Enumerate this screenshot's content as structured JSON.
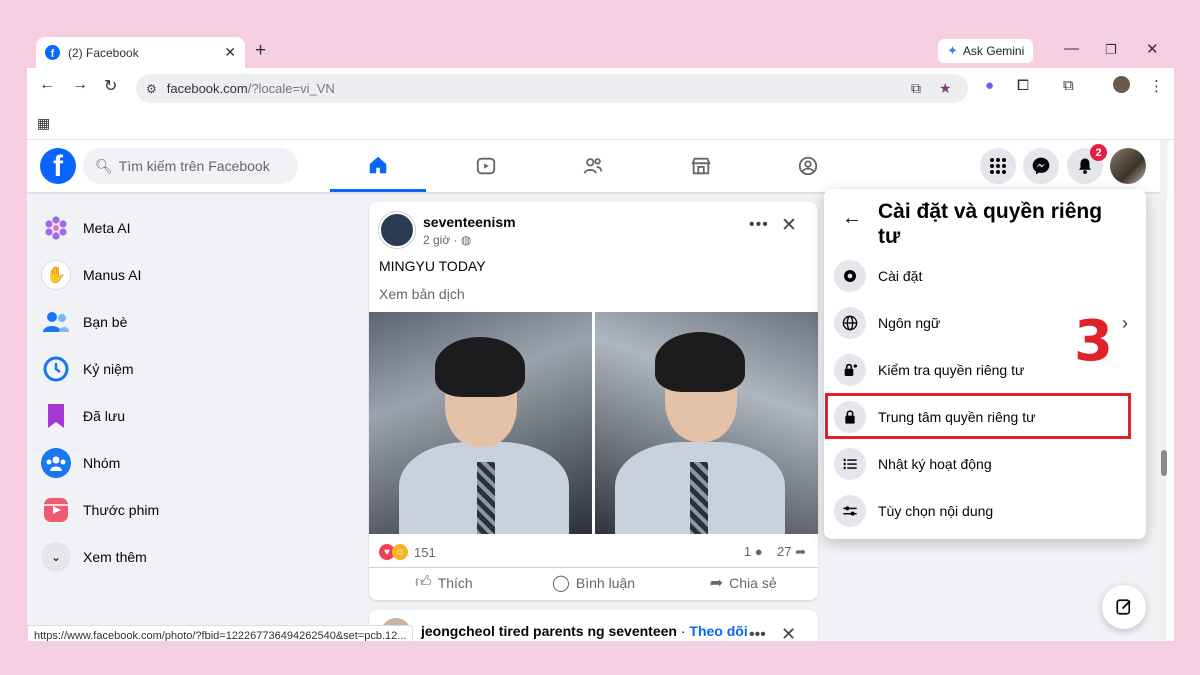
{
  "browser": {
    "tab_title": "(2) Facebook",
    "tab_close": "✕",
    "new_tab": "+",
    "ask_gemini": "Ask Gemini",
    "url_main": "facebook.com",
    "url_rest": "/?locale=vi_VN",
    "status_url": "https://www.facebook.com/photo/?fbid=122267736494262540&set=pcb.12..."
  },
  "fb": {
    "search_placeholder": "Tìm kiếm trên Facebook",
    "notification_count": "2",
    "sidebar": [
      {
        "label": "Meta AI",
        "icon": "meta-ai-icon"
      },
      {
        "label": "Manus AI",
        "icon": "manus-icon"
      },
      {
        "label": "Bạn bè",
        "icon": "friends-icon"
      },
      {
        "label": "Kỷ niệm",
        "icon": "memories-icon"
      },
      {
        "label": "Đã lưu",
        "icon": "saved-icon"
      },
      {
        "label": "Nhóm",
        "icon": "groups-icon"
      },
      {
        "label": "Thước phim",
        "icon": "reels-icon"
      },
      {
        "label": "Xem thêm",
        "icon": "chevron-down-icon"
      }
    ],
    "post": {
      "author": "seventeenism",
      "time": "2 giờ · ",
      "text": "MINGYU TODAY",
      "translate": "Xem bản dịch",
      "reaction_count": "151",
      "comment_count": "1",
      "share_count": "27",
      "like": "Thích",
      "comment": "Bình luận",
      "share": "Chia sẻ"
    },
    "post2": {
      "text": "jeongcheol tired parents ng seventeen",
      "separator": " · ",
      "follow": "Theo dõi"
    },
    "settings_menu": {
      "title": "Cài đặt và quyền riêng tư",
      "items": [
        {
          "label": "Cài đặt",
          "icon": "gear-icon"
        },
        {
          "label": "Ngôn ngữ",
          "icon": "globe-icon"
        },
        {
          "label": "Kiểm tra quyền riêng tư",
          "icon": "privacy-check-icon"
        },
        {
          "label": "Trung tâm quyền riêng tư",
          "icon": "lock-icon"
        },
        {
          "label": "Nhật ký hoạt động",
          "icon": "list-icon"
        },
        {
          "label": "Tùy chọn nội dung",
          "icon": "sliders-icon"
        }
      ],
      "step_number": "3"
    }
  },
  "colors": {
    "brand": "#0866ff",
    "highlight": "#e0202a",
    "page_bg": "#f5cfe0"
  }
}
